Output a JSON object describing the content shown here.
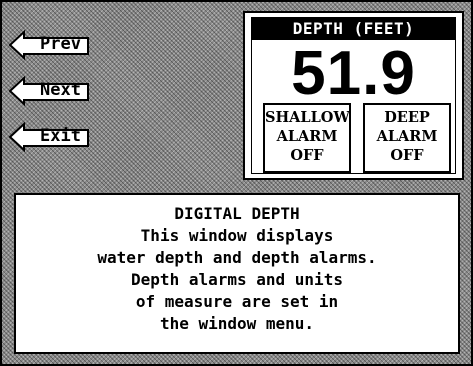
{
  "nav": {
    "prev_label": "Prev",
    "next_label": "Next",
    "exit_label": "Exit"
  },
  "depth_window": {
    "header": "DEPTH (FEET)",
    "value": "51.9",
    "shallow_alarm": {
      "line1": "SHALLOW",
      "line2": "ALARM",
      "status": "OFF"
    },
    "deep_alarm": {
      "line1": "DEEP",
      "line2": "ALARM",
      "status": "OFF"
    }
  },
  "info": {
    "title": "DIGITAL DEPTH",
    "lines": [
      "This window displays",
      "water depth and depth alarms.",
      "Depth alarms and units",
      "of measure are set in",
      "the window menu."
    ]
  },
  "colors": {
    "background": "#8a8a8a",
    "panel": "#ffffff",
    "ink": "#000000"
  }
}
